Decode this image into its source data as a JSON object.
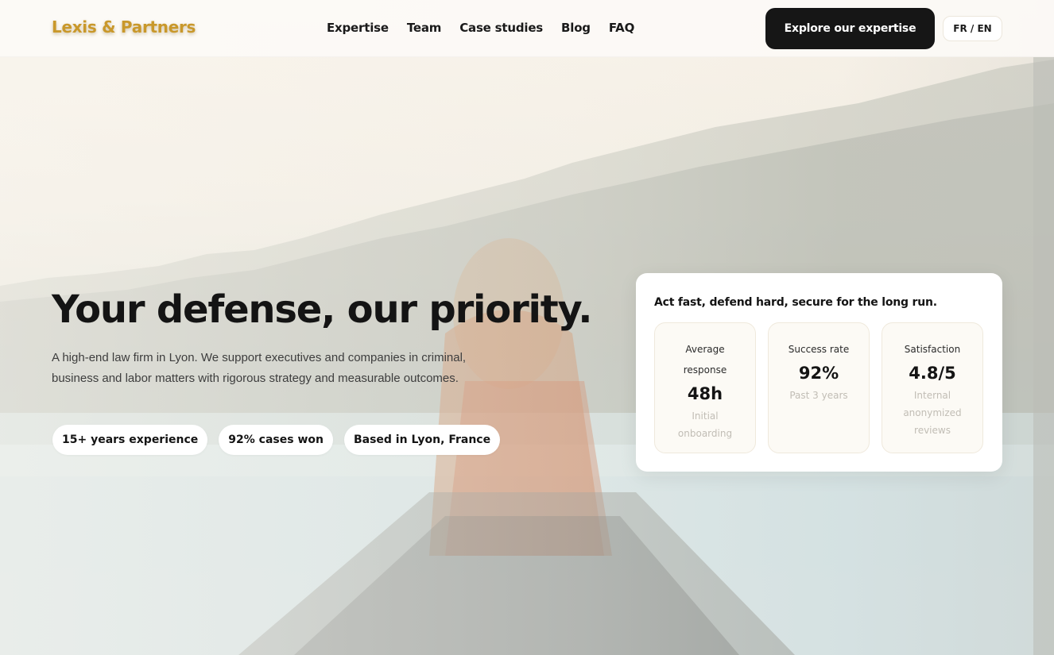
{
  "header": {
    "logo": "Lexis & Partners",
    "nav": [
      "Expertise",
      "Team",
      "Case studies",
      "Blog",
      "FAQ"
    ],
    "cta_label": "Explore our expertise",
    "lang_label": "FR / EN"
  },
  "hero": {
    "title": "Your defense, our priority.",
    "description": "A high-end law firm in Lyon. We support executives and companies in criminal, business and labor matters with rigorous strategy and measurable outcomes.",
    "chips": [
      "15+ years experience",
      "92% cases won",
      "Based in Lyon, France"
    ]
  },
  "stats_card": {
    "title": "Act fast, defend hard, secure for the long run.",
    "stats": [
      {
        "label": "Average response",
        "value": "48h",
        "note": "Initial onboarding"
      },
      {
        "label": "Success rate",
        "value": "92%",
        "note": "Past 3 years"
      },
      {
        "label": "Satisfaction",
        "value": "4.8/5",
        "note": "Internal anonymized reviews"
      }
    ]
  },
  "colors": {
    "brand_gold": "#c9982b",
    "cta_bg": "#161616",
    "text": "#141414",
    "muted_note": "#c1bdb5"
  }
}
